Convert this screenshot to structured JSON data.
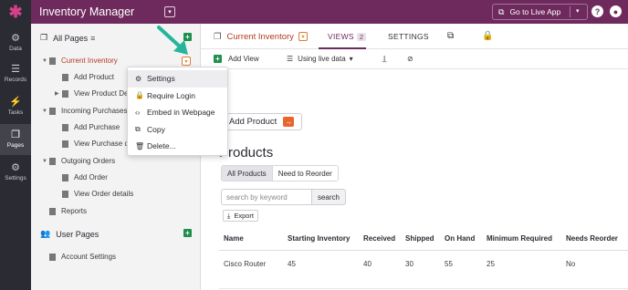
{
  "app": {
    "title": "Inventory Manager",
    "live_app_label": "Go to Live App",
    "help_icon": "question-circle-icon",
    "user_icon": "user-circle-icon"
  },
  "rail": [
    {
      "label": "Data",
      "icon": "data-icon"
    },
    {
      "label": "Records",
      "icon": "database-icon"
    },
    {
      "label": "Tasks",
      "icon": "bolt-icon"
    },
    {
      "label": "Pages",
      "icon": "pages-icon",
      "active": true
    },
    {
      "label": "Settings",
      "icon": "gear-icon"
    }
  ],
  "pages_panel": {
    "title": "All Pages",
    "tree": [
      {
        "label": "Current Inventory",
        "level": 0,
        "expanded": true,
        "current": true
      },
      {
        "label": "Add Product",
        "level": 1
      },
      {
        "label": "View Product De",
        "level": 1,
        "expandable": true
      },
      {
        "label": "Incoming Purchases",
        "level": 0,
        "expanded": true
      },
      {
        "label": "Add Purchase",
        "level": 1
      },
      {
        "label": "View Purchase d",
        "level": 1
      },
      {
        "label": "Outgoing Orders",
        "level": 0,
        "expanded": true
      },
      {
        "label": "Add Order",
        "level": 1
      },
      {
        "label": "View Order details",
        "level": 1
      },
      {
        "label": "Reports",
        "level": 0
      }
    ],
    "user_pages_title": "User Pages",
    "user_pages": [
      {
        "label": "Account Settings"
      }
    ]
  },
  "context_menu": [
    {
      "label": "Settings",
      "icon": "gear-icon",
      "hover": true
    },
    {
      "label": "Require Login",
      "icon": "lock-icon"
    },
    {
      "label": "Embed in Webpage",
      "icon": "code-icon"
    },
    {
      "label": "Copy",
      "icon": "copy-icon"
    },
    {
      "label": "Delete...",
      "icon": "trash-icon"
    }
  ],
  "main": {
    "page_name": "Current Inventory",
    "tabs": [
      {
        "label": "VIEWS",
        "count": "2",
        "active": true
      },
      {
        "label": "SETTINGS"
      }
    ],
    "toolbar": {
      "add_view": "Add View",
      "live_data": "Using live data"
    },
    "add_button": "Add Product",
    "heading": "Products",
    "filters": [
      {
        "label": "All Products",
        "active": true
      },
      {
        "label": "Need to Reorder"
      }
    ],
    "search_placeholder": "search by keyword",
    "search_button": "search",
    "export_label": "Export",
    "table": {
      "columns": [
        "Name",
        "Starting Inventory",
        "Received",
        "Shipped",
        "On Hand",
        "Minimum Required",
        "Needs Reorder"
      ],
      "rows": [
        [
          "Cisco Router",
          "45",
          "40",
          "30",
          "55",
          "25",
          "No"
        ]
      ]
    }
  },
  "colors": {
    "header": "#6e2a5d",
    "rail": "#2b2b33",
    "accent_orange": "#e8662e",
    "green": "#1e8f4d",
    "current_page": "#b33a1f"
  }
}
